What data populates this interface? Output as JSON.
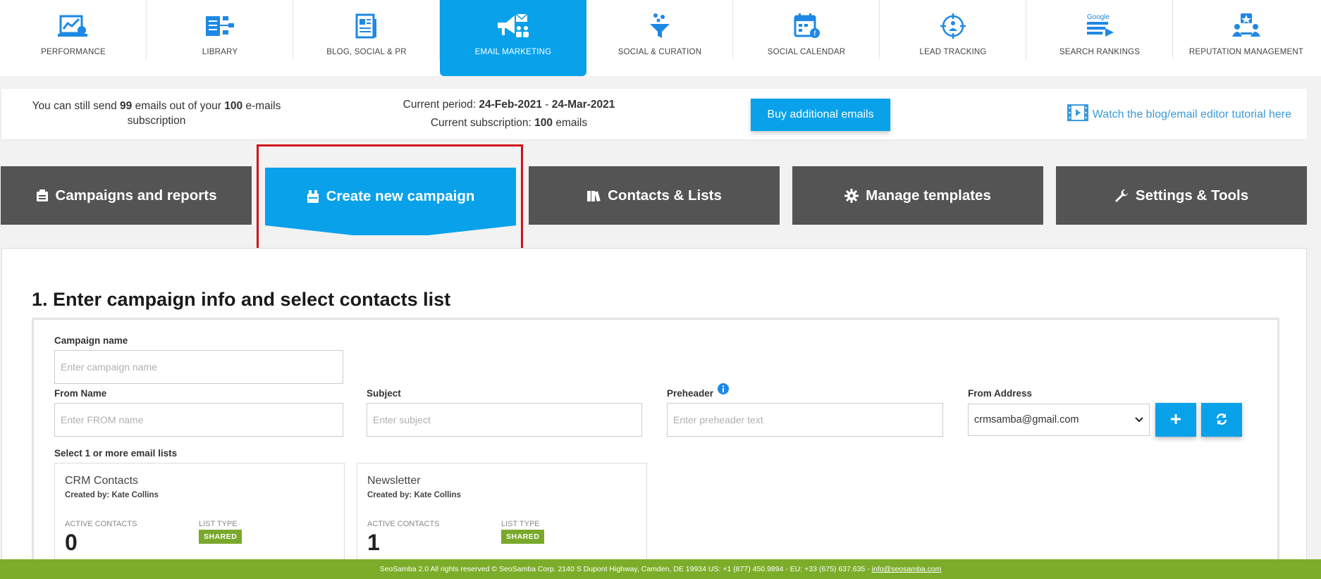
{
  "nav": {
    "items": [
      {
        "label": "PERFORMANCE",
        "icon": "performance-chart-icon"
      },
      {
        "label": "LIBRARY",
        "icon": "library-icon"
      },
      {
        "label": "BLOG, SOCIAL & PR",
        "icon": "blog-document-icon"
      },
      {
        "label": "EMAIL MARKETING",
        "icon": "email-marketing-megaphone-icon",
        "active": true
      },
      {
        "label": "SOCIAL & CURATION",
        "icon": "funnel-curation-icon"
      },
      {
        "label": "SOCIAL CALENDAR",
        "icon": "calendar-icon"
      },
      {
        "label": "LEAD TRACKING",
        "icon": "target-people-icon"
      },
      {
        "label": "SEARCH RANKINGS",
        "icon": "google-rankings-icon",
        "icon_text": "Google"
      },
      {
        "label": "REPUTATION MANAGEMENT",
        "icon": "reputation-star-icon"
      }
    ]
  },
  "infobar": {
    "quota_prefix": "You can still send ",
    "quota_remaining": "99",
    "quota_middle": " emails out of your ",
    "quota_total": "100",
    "quota_suffix": " e-mails subscription",
    "period_label": "Current period: ",
    "period_start": "24-Feb-2021",
    "period_sep": " - ",
    "period_end": "24-Mar-2021",
    "subscription_label": "Current subscription: ",
    "subscription_value": "100",
    "subscription_suffix": " emails",
    "buy_button": "Buy additional emails",
    "tutorial_link": "Watch the blog/email editor tutorial here"
  },
  "tabs": [
    {
      "label": "Campaigns and reports",
      "icon": "reports-icon"
    },
    {
      "label": "Create new campaign",
      "icon": "create-campaign-icon",
      "active": true
    },
    {
      "label": "Contacts & Lists",
      "icon": "contacts-books-icon"
    },
    {
      "label": "Manage templates",
      "icon": "gear-icon"
    },
    {
      "label": "Settings & Tools",
      "icon": "wrench-icon"
    }
  ],
  "form": {
    "section_title": "1. Enter campaign info and select contacts list",
    "campaign_name_label": "Campaign name",
    "campaign_name_placeholder": "Enter campaign name",
    "from_name_label": "From Name",
    "from_name_placeholder": "Enter FROM name",
    "subject_label": "Subject",
    "subject_placeholder": "Enter subject",
    "preheader_label": "Preheader",
    "preheader_placeholder": "Enter preheader text",
    "from_address_label": "From Address",
    "from_address_value": "crmsamba@gmail.com",
    "lists_label": "Select 1 or more email lists"
  },
  "lists": [
    {
      "name": "CRM Contacts",
      "creator": "Created by: Kate Collins",
      "active_label": "ACTIVE CONTACTS",
      "active_count": "0",
      "type_label": "LIST TYPE",
      "type": "SHARED"
    },
    {
      "name": "Newsletter",
      "creator": "Created by: Kate Collins",
      "active_label": "ACTIVE CONTACTS",
      "active_count": "1",
      "type_label": "LIST TYPE",
      "type": "SHARED"
    }
  ],
  "footer": {
    "text": "SeoSamba 2.0  All rights reserved © SeoSamba Corp. 2140 S Dupont Highway, Camden, DE 19934 US: +1 (877) 450.9894 - EU: +33 (675) 637.635 - ",
    "email": "info@seosamba.com"
  },
  "colors": {
    "accent": "#08a1ea",
    "tab_dark": "#545454",
    "footer_green": "#7cad2a",
    "badge_green": "#79a82c",
    "highlight_red": "#d0121b",
    "icon_blue": "#1e88e5"
  }
}
